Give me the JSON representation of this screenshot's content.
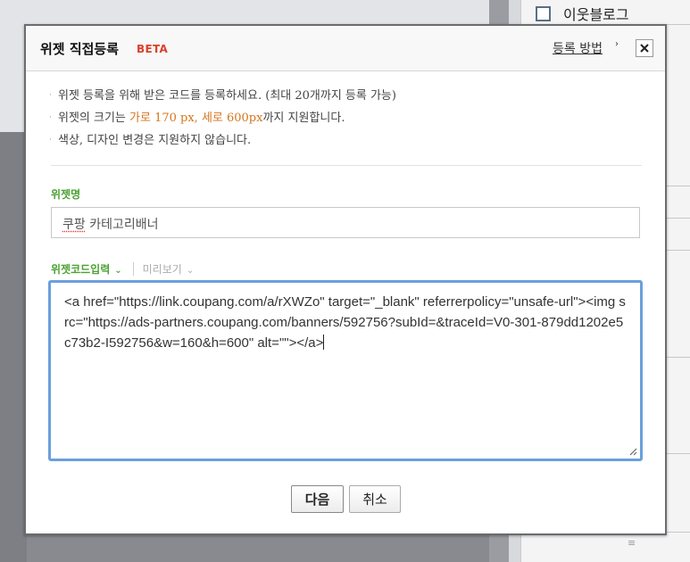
{
  "background": {
    "neighbor_blog_label": "이웃블로그"
  },
  "dialog": {
    "title": "위젯 직접등록",
    "beta_badge": "BETA",
    "help_link": "등록 방법",
    "notes": [
      {
        "text": "위젯 등록을 위해 받은 코드를 등록하세요. (최대 20개까지 등록 가능)"
      },
      {
        "before": "위젯의 크기는 ",
        "highlight": "가로 170 px, 세로 600px",
        "after": "까지 지원합니다."
      },
      {
        "text": "색상, 디자인 변경은 지원하지 않습니다."
      }
    ],
    "widget_name": {
      "label": "위젯명",
      "value_part1": "쿠팡",
      "value_part2": " 카테고리배너"
    },
    "code_tabs": {
      "code_input": "위젯코드입력",
      "preview": "미리보기"
    },
    "code_value": "<a href=\"https://link.coupang.com/a/rXWZo\" target=\"_blank\" referrerpolicy=\"unsafe-url\"><img src=\"https://ads-partners.coupang.com/banners/592756?subId=&traceId=V0-301-879dd1202e5c73b2-I592756&w=160&h=600\" alt=\"\"></a>",
    "buttons": {
      "next": "다음",
      "cancel": "취소"
    },
    "colors": {
      "accent_green": "#4aa233",
      "beta_red": "#d9412c",
      "highlight_orange": "#d5751c",
      "focus_blue": "#6b9fdc"
    }
  }
}
